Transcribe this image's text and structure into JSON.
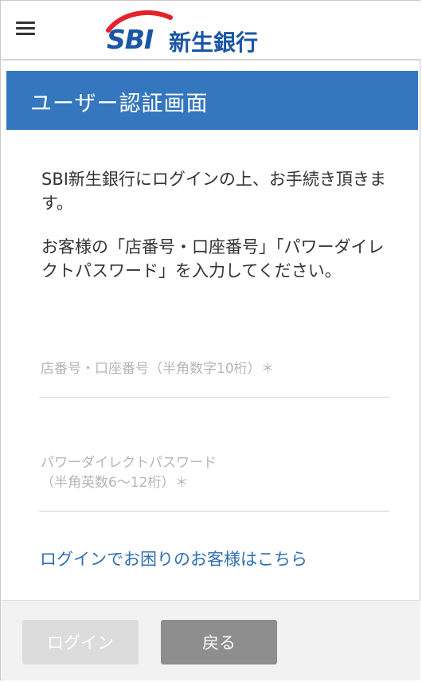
{
  "logo": {
    "mark": "SBI",
    "name": "新生銀行"
  },
  "header": {
    "title": "ユーザー認証画面"
  },
  "intro": {
    "line1": "SBI新生銀行にログインの上、お手続き頂きます。",
    "line2": "お客様の「店番号・口座番号」「パワーダイレクトパスワード」を入力してください。"
  },
  "fields": {
    "account": {
      "label": "店番号・口座番号（半角数字10桁）＊"
    },
    "password": {
      "label_line1": "パワーダイレクトパスワード",
      "label_line2": "（半角英数6〜12桁）＊"
    }
  },
  "help_link": "ログインでお困りのお客様はこちら",
  "buttons": {
    "login": "ログイン",
    "back": "戻る"
  },
  "colors": {
    "header_bg": "#3477bf",
    "logo_blue": "#1a56a6",
    "logo_red": "#e3232c",
    "link": "#2f6fb3",
    "login_disabled": "#dcdcdc",
    "back_button": "#8e8e8e"
  },
  "icons": {
    "menu": "hamburger-menu-icon"
  }
}
